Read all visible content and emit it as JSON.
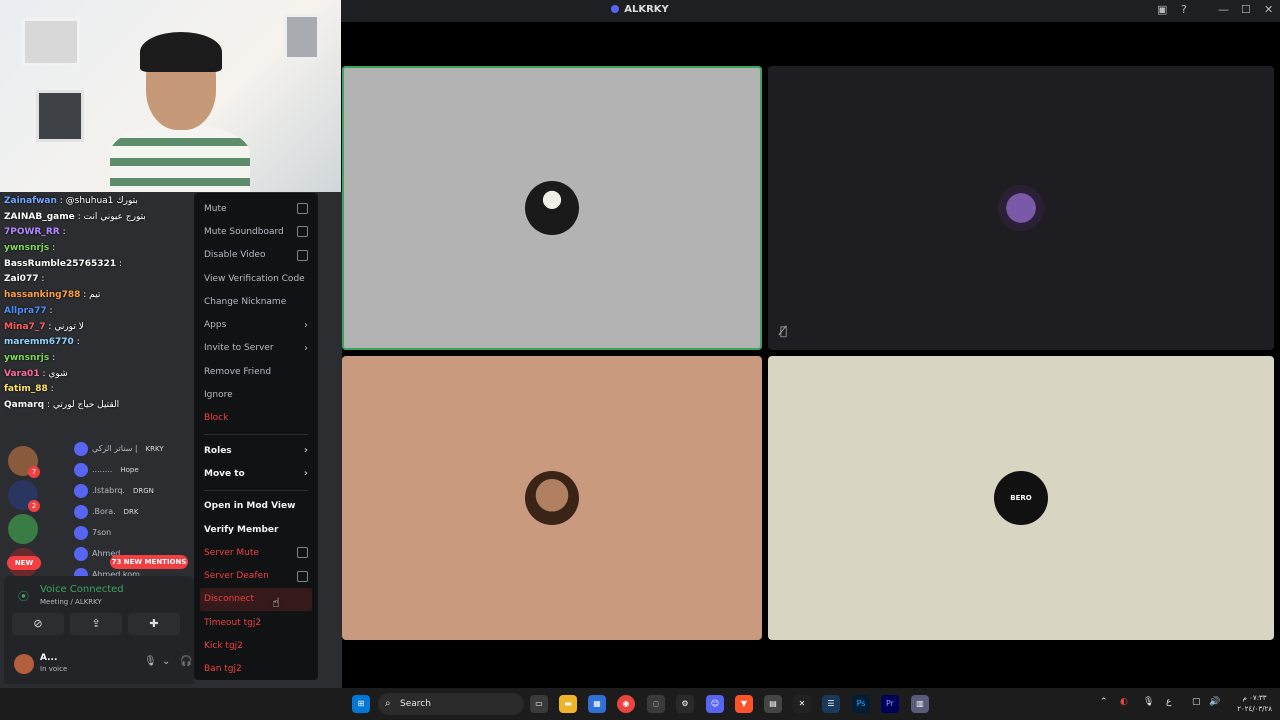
{
  "window": {
    "title": "ALKRKY"
  },
  "chat": [
    {
      "user": "Zainafwan",
      "text": ": @shuhua1 بتورك",
      "color": "#6fa8ff"
    },
    {
      "user": "ZAINAB_game",
      "text": ": بتورج عيوني انت",
      "color": "#ffffff"
    },
    {
      "user": "7POWR_RR",
      "text": ":",
      "color": "#b388ff"
    },
    {
      "user": "ywnsnrjs",
      "text": ":",
      "color": "#7ed957"
    },
    {
      "user": "BassRumble25765321",
      "text": ":",
      "color": "#ffffff"
    },
    {
      "user": "Zai077",
      "text": ":",
      "color": "#ffffff"
    },
    {
      "user": "hassanking788",
      "text": ": تيم",
      "color": "#ff9f43"
    },
    {
      "user": "Allpra77",
      "text": ":",
      "color": "#4c8dff"
    },
    {
      "user": "Mina7_7",
      "text": ": لا تورني",
      "color": "#ff5c5c"
    },
    {
      "user": "maremm6770",
      "text": ":",
      "color": "#8fd3ff"
    },
    {
      "user": "ywnsnrjs",
      "text": ":",
      "color": "#7ed957"
    },
    {
      "user": "Vara01",
      "text": ": شوي",
      "color": "#ff6b9a"
    },
    {
      "user": "fatim_88",
      "text": ":",
      "color": "#ffe066"
    },
    {
      "user": "Qamarq",
      "text": ": القتيل حياج لورتي",
      "color": "#ffffff"
    }
  ],
  "members": [
    {
      "name": "سناتر الزكي |",
      "tag": "KRKY"
    },
    {
      "name": "........",
      "tag": "Hope"
    },
    {
      "name": ".Istabrq.",
      "tag": "DRGN"
    },
    {
      "name": ".Bora.",
      "tag": "DRK"
    },
    {
      "name": "7son",
      "tag": ""
    },
    {
      "name": "Ahmed",
      "tag": ""
    },
    {
      "name": "Ahmed.kom",
      "tag": ""
    }
  ],
  "servers": [
    {
      "badge": "7"
    },
    {
      "badge": "2"
    },
    {
      "badge": ""
    },
    {
      "badge": ""
    }
  ],
  "pills": {
    "new": "NEW",
    "mentions": "73 NEW MENTIONS"
  },
  "voice": {
    "status": "Voice Connected",
    "channel": "Meeting / ALKRKY",
    "user_name": "A...",
    "user_status": "In voice"
  },
  "context_menu": {
    "group1": [
      {
        "label": "Mute",
        "control": "checkbox"
      },
      {
        "label": "Mute Soundboard",
        "control": "checkbox"
      },
      {
        "label": "Disable Video",
        "control": "checkbox"
      },
      {
        "label": "View Verification Code",
        "control": ""
      },
      {
        "label": "Change Nickname",
        "control": ""
      },
      {
        "label": "Apps",
        "control": "arrow"
      },
      {
        "label": "Invite to Server",
        "control": "arrow"
      },
      {
        "label": "Remove Friend",
        "control": ""
      },
      {
        "label": "Ignore",
        "control": ""
      },
      {
        "label": "Block",
        "control": "",
        "danger": true
      }
    ],
    "group2": [
      {
        "label": "Roles",
        "control": "arrow",
        "bold": true
      },
      {
        "label": "Move to",
        "control": "arrow",
        "bold": true
      }
    ],
    "group3": [
      {
        "label": "Open in Mod View",
        "bold": true
      },
      {
        "label": "Verify Member",
        "bold": true
      },
      {
        "label": "Server Mute",
        "control": "checkbox",
        "danger": true
      },
      {
        "label": "Server Deafen",
        "control": "checkbox",
        "danger": true
      },
      {
        "label": "Disconnect",
        "danger": true,
        "hover": true
      },
      {
        "label": "Timeout tgj2",
        "danger": true
      },
      {
        "label": "Kick tgj2",
        "danger": true
      },
      {
        "label": "Ban tgj2",
        "danger": true
      }
    ]
  },
  "tiles": [
    {
      "avatar_text": "",
      "bg": "#b3b3b3",
      "speaking": true,
      "muted": false
    },
    {
      "avatar_text": "",
      "bg": "#1e1d22",
      "speaking": false,
      "muted": true
    },
    {
      "avatar_text": "",
      "bg": "#c99a7e",
      "speaking": false,
      "muted": false
    },
    {
      "avatar_text": "BERO",
      "bg": "#d9d5c3",
      "speaking": false,
      "muted": false
    }
  ],
  "taskbar": {
    "search_label": "Search",
    "clock_time": "٠٧:٣٣ م",
    "clock_date": "٢٠٢٤/٠٣/٢٨",
    "lang": "ع"
  },
  "colors": {
    "discord_blurple": "#5865f2",
    "danger": "#f23f42",
    "green": "#3ba55d"
  }
}
